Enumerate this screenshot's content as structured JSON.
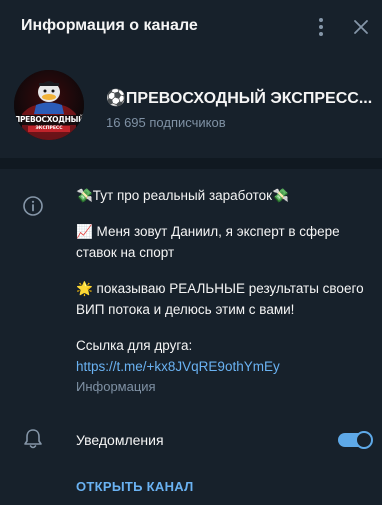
{
  "header": {
    "title": "Информация о канале"
  },
  "profile": {
    "avatar_text": "ПРЕВОСХОДНЫЙ",
    "avatar_subtext": "ЭКСПРЕСС",
    "name": "⚽ПРЕВОСХОДНЫЙ ЭКСПРЕСС...",
    "subscribers": "16 695 подписчиков"
  },
  "description": {
    "line1": "💸Тут про реальный заработок💸",
    "line2": "📈 Меня зовут Даниил, я эксперт в сфере ставок на спорт",
    "line3": "🌟 показываю РЕАЛЬНЫЕ результаты своего ВИП потока и делюсь этим с вами!",
    "line4": "Ссылка для друга:",
    "link": "https://t.me/+kx8JVqRE9othYmEy"
  },
  "info_caption": "Информация",
  "notifications": {
    "label": "Уведомления",
    "enabled": true
  },
  "open_channel_label": "ОТКРЫТЬ КАНАЛ",
  "colors": {
    "background": "#17212b",
    "accent": "#6ab2f2",
    "secondary_text": "#7f91a4"
  },
  "icons": {
    "menu": "more-vertical-icon",
    "close": "close-icon",
    "info": "info-icon",
    "bell": "bell-icon"
  }
}
